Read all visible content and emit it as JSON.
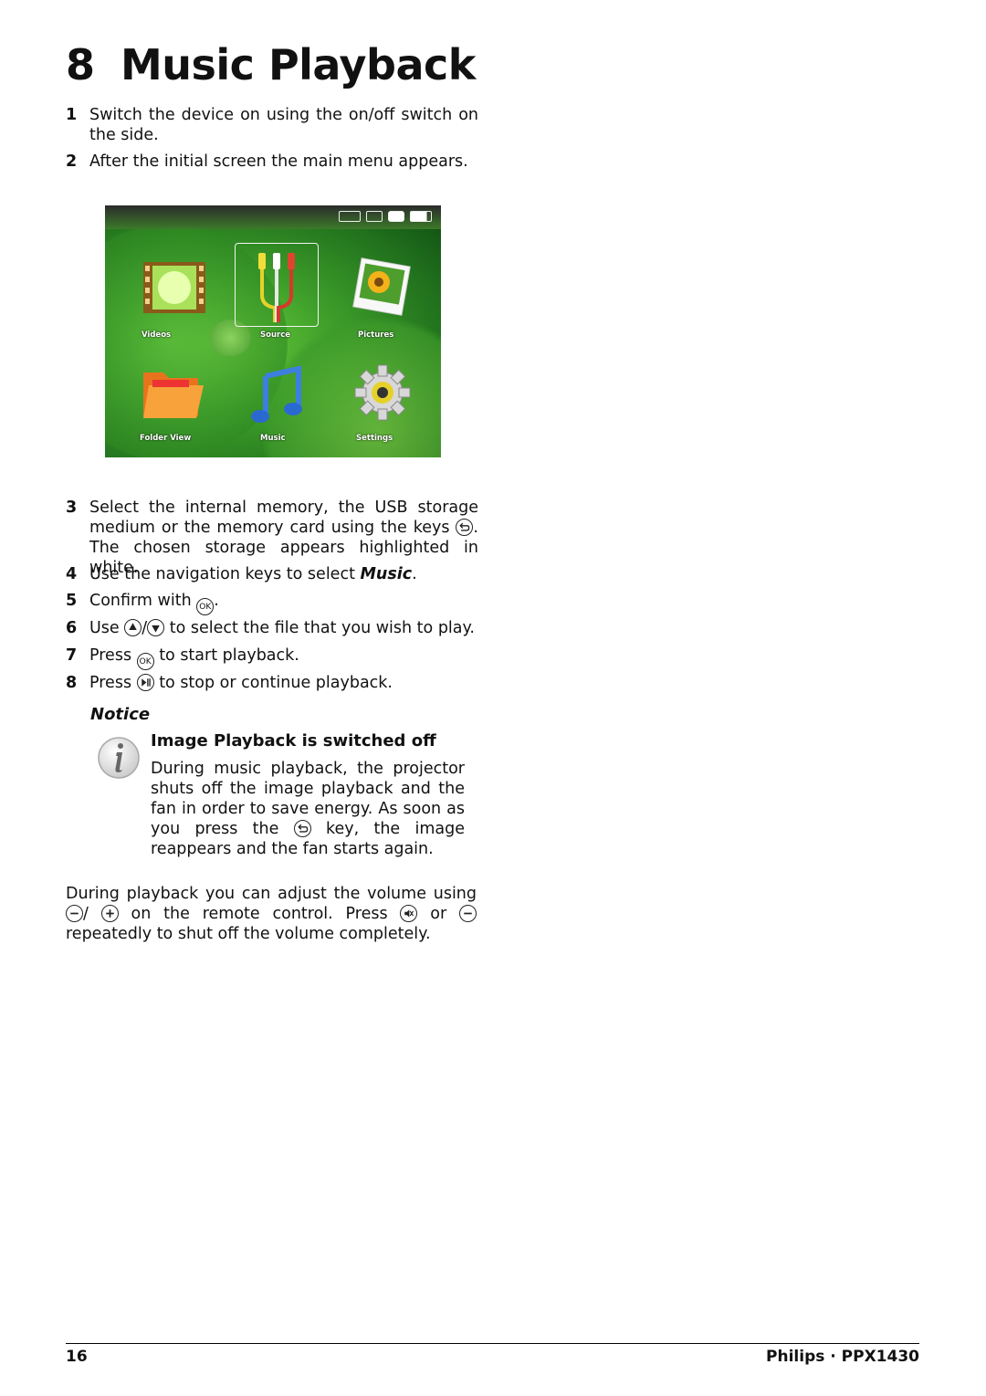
{
  "chapter": {
    "number": "8",
    "title": "Music Playback"
  },
  "steps_top": [
    {
      "n": "1",
      "text": "Switch the device on using the on/off switch on the side."
    },
    {
      "n": "2",
      "text": "After the initial screen the main menu appears."
    }
  ],
  "screen": {
    "status_icons": [
      "usb-storage-icon",
      "sd-card-icon",
      "internal-memory-icon",
      "battery-icon"
    ],
    "tiles": [
      {
        "label": "Videos",
        "icon": "film-icon"
      },
      {
        "label": "Source",
        "icon": "av-cables-icon",
        "selected": true
      },
      {
        "label": "Pictures",
        "icon": "photo-icon"
      },
      {
        "label": "Folder View",
        "icon": "folder-icon"
      },
      {
        "label": "Music",
        "icon": "music-note-icon"
      },
      {
        "label": "Settings",
        "icon": "gear-icon"
      }
    ],
    "colors": {
      "background": "#3fa02a",
      "label": "#ffffff"
    }
  },
  "steps": [
    {
      "n": "3",
      "before": "Select the internal memory, the USB storage medium or the memory card using the keys ",
      "key": "back-key-icon",
      "after": ". The chosen storage appears highlighted in white."
    },
    {
      "n": "4",
      "before": "Use the navigation keys to select ",
      "emph": "Music",
      "after": "."
    },
    {
      "n": "5",
      "before": "Confirm with ",
      "key": "ok-key-icon",
      "key_label": "OK",
      "after": "."
    },
    {
      "n": "6",
      "before": "Use ",
      "key": "up-key-icon",
      "sep": "/",
      "key2": "down-key-icon",
      "after": " to select the file that you wish to play."
    },
    {
      "n": "7",
      "before": "Press ",
      "key": "ok-key-icon",
      "key_label": "OK",
      "after": " to start playback."
    },
    {
      "n": "8",
      "before": "Press ",
      "key": "play-pause-key-icon",
      "after": " to stop or continue playback."
    }
  ],
  "notice": {
    "heading": "Notice",
    "title": "Image Playback is switched off",
    "body_before": "During music playback, the projector shuts off the image playback and the fan in order to save energy. As soon as you press the ",
    "body_after": " key, the image reappears and the fan starts again."
  },
  "volume_paragraph": {
    "p1": "During playback you can adjust the volume using ",
    "p2": "/ ",
    "p3": " on the remote control. Press ",
    "p4": " or ",
    "p5": " repeatedly to shut off the volume completely."
  },
  "footer": {
    "page": "16",
    "brand": "Philips · PPX1430"
  }
}
